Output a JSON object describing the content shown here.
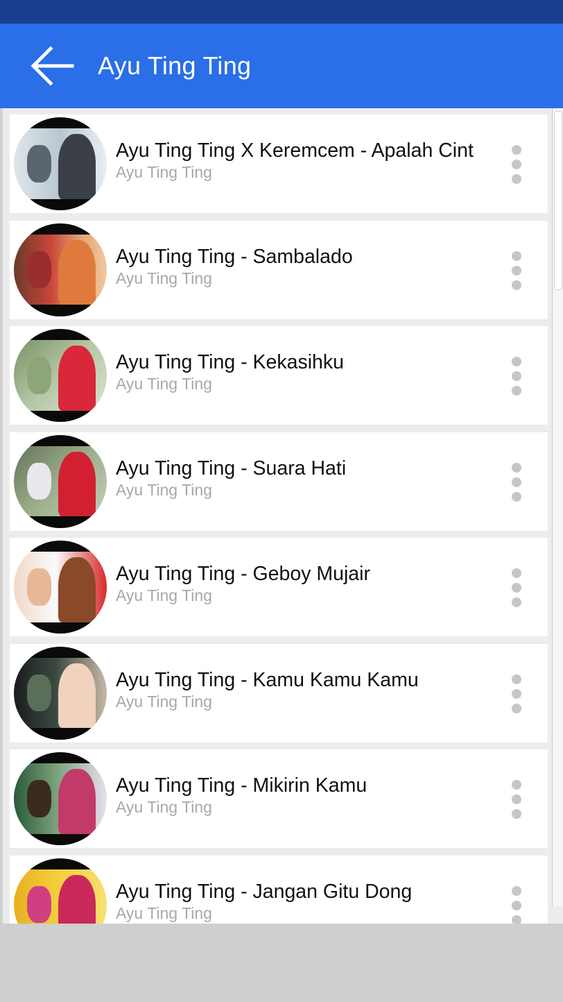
{
  "app_bar": {
    "title": "Ayu Ting Ting",
    "back_icon": "arrow-left-icon",
    "color": "#2a6ee8",
    "status_color": "#1b3f90"
  },
  "songs": [
    {
      "title": "Ayu Ting Ting X Keremcem - Apalah Cint",
      "artist": "Ayu Ting Ting",
      "thumb": {
        "bg": "linear-gradient(90deg,#dfe6ea 0%,#b9c7cf 50%,#e8eef2 100%)",
        "fig": "#3a3f48",
        "fig2": "#5b6570"
      }
    },
    {
      "title": "Ayu Ting Ting - Sambalado",
      "artist": "Ayu Ting Ting",
      "thumb": {
        "bg": "linear-gradient(90deg,#6b3a2a 0%,#c9453a 40%,#e0a070 70%,#f2c9a0 100%)",
        "fig": "#e07a3c",
        "fig2": "#9a2d2d"
      }
    },
    {
      "title": "Ayu Ting Ting - Kekasihku",
      "artist": "Ayu Ting Ting",
      "thumb": {
        "bg": "linear-gradient(135deg,#6f8a5c 0%,#b7c7a8 50%,#dfe6d4 100%)",
        "fig": "#d8283a",
        "fig2": "#8ea57a"
      }
    },
    {
      "title": "Ayu Ting Ting - Suara Hati",
      "artist": "Ayu Ting Ting",
      "thumb": {
        "bg": "linear-gradient(135deg,#5d6b50 0%,#9caf8c 50%,#c9d2bd 100%)",
        "fig": "#d22030",
        "fig2": "#e8e8ee"
      }
    },
    {
      "title": "Ayu Ting Ting - Geboy Mujair",
      "artist": "Ayu Ting Ting",
      "thumb": {
        "bg": "linear-gradient(90deg,#f0d8c8 0%,#fafafa 45%,#d82a2a 100%)",
        "fig": "#8a4a2a",
        "fig2": "#e6b896"
      }
    },
    {
      "title": "Ayu Ting Ting - Kamu Kamu Kamu",
      "artist": "Ayu Ting Ting",
      "thumb": {
        "bg": "linear-gradient(90deg,#1a1c1e 0%,#3a4a40 45%,#c8b8a8 100%)",
        "fig": "#f0d2bf",
        "fig2": "#5b6e5a"
      }
    },
    {
      "title": "Ayu Ting Ting - Mikirin Kamu",
      "artist": "Ayu Ting Ting",
      "thumb": {
        "bg": "linear-gradient(90deg,#2a5a3a 0%,#7aa07a 45%,#e8e0f0 100%)",
        "fig": "#c23a6a",
        "fig2": "#3a2a20"
      }
    },
    {
      "title": "Ayu Ting Ting - Jangan Gitu Dong",
      "artist": "Ayu Ting Ting",
      "thumb": {
        "bg": "linear-gradient(90deg,#e8b020 0%,#f4d040 50%,#f8e070 100%)",
        "fig": "#c8285a",
        "fig2": "#d04080"
      }
    }
  ],
  "menu_icon": "more-vert-icon",
  "colors": {
    "list_bg": "#ececec",
    "item_bg": "#ffffff",
    "artist_text": "#a8a8a8",
    "bottom_panel": "#cfcfcf"
  }
}
